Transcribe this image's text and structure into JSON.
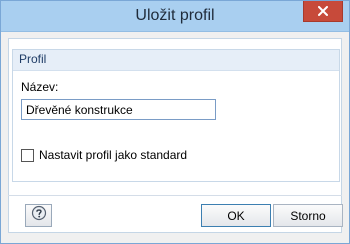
{
  "window": {
    "title": "Uložit profil"
  },
  "profile_group": {
    "title": "Profil",
    "name_label": "Název:",
    "name_value": "Dřevěné konstrukce",
    "default_checkbox_label": "Nastavit profil jako standard",
    "default_checked": false
  },
  "buttons": {
    "ok_label": "OK",
    "cancel_label": "Storno"
  },
  "icons": {
    "close": "close-icon",
    "help": "help-icon"
  },
  "colors": {
    "titlebar": "#a9cff0",
    "close_button": "#c74a3a",
    "group_header": "#e6eef8"
  }
}
